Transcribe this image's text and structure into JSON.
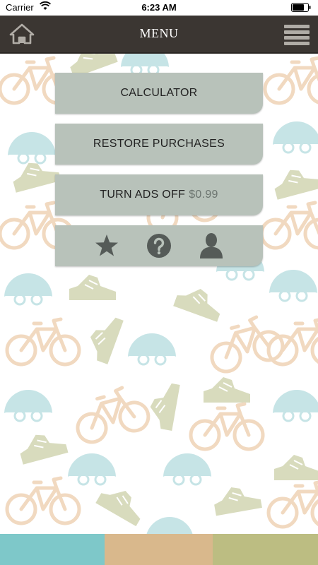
{
  "status_bar": {
    "carrier": "Carrier",
    "time": "6:23 AM"
  },
  "header": {
    "title": "MENU",
    "left_icon": "home-icon",
    "right_icon": "hamburger-menu-icon",
    "background_color": "#3b3632"
  },
  "menu": {
    "items": [
      {
        "label": "CALCULATOR"
      },
      {
        "label": "RESTORE PURCHASES"
      },
      {
        "label": "TURN ADS OFF",
        "price": "$0.99"
      }
    ],
    "button_color": "#b8c2ba",
    "icons": [
      "star-icon",
      "help-icon",
      "profile-icon"
    ]
  },
  "footer": {
    "color_strips": [
      "#7ec8c9",
      "#d9b88c",
      "#bcbd82"
    ]
  }
}
